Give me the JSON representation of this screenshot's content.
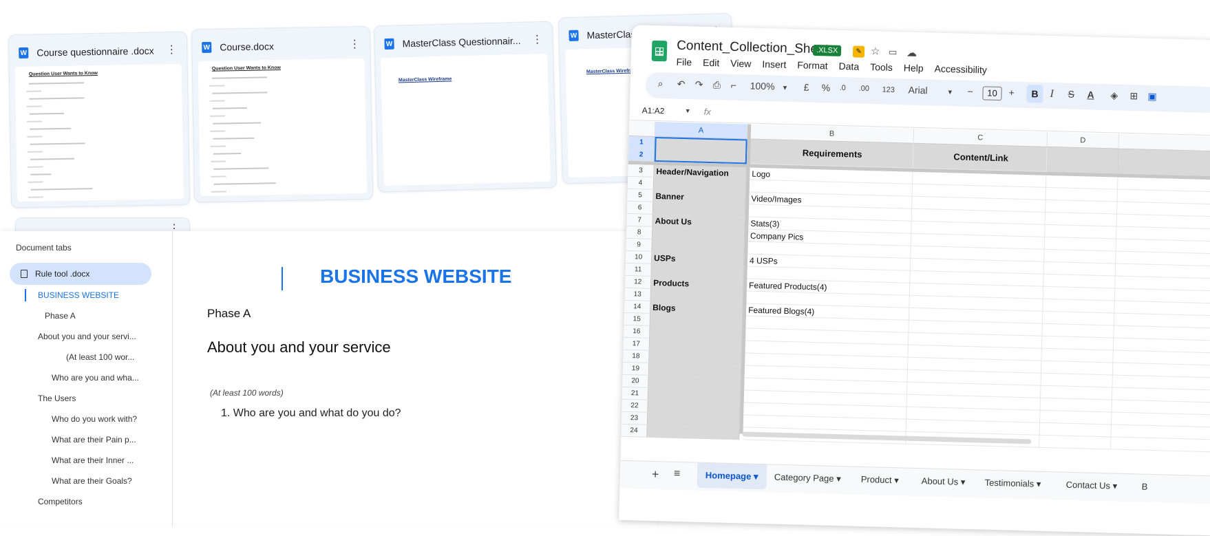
{
  "file_cards": [
    {
      "name": "Course questionnaire .docx",
      "thumb_title": "Question User Wants to Know"
    },
    {
      "name": "Course.docx",
      "thumb_title": "Question User Wants to Know"
    },
    {
      "name": "MasterClass Questionnair...",
      "thumb_title": "MasterClass Wireframe"
    },
    {
      "name": "MasterClass.docx",
      "thumb_title": "MasterClass Wirefra"
    }
  ],
  "file_icon_letter": "W",
  "docs": {
    "tabs_label": "Document tabs",
    "active_doc": "Rule tool .docx",
    "outline": [
      {
        "label": "BUSINESS WEBSITE",
        "level": 1,
        "current": true
      },
      {
        "label": "Phase A",
        "level": 2
      },
      {
        "label": "About you and your servi...",
        "level": 1
      },
      {
        "label": "(At least 100 wor...",
        "level": 3
      },
      {
        "label": "Who are you and wha...",
        "level": 2
      },
      {
        "label": "The Users",
        "level": 1
      },
      {
        "label": "Who do you work with?",
        "level": 2
      },
      {
        "label": "What are their Pain p...",
        "level": 2
      },
      {
        "label": "What are their Inner ...",
        "level": 2
      },
      {
        "label": "What are their Goals?",
        "level": 2
      },
      {
        "label": "Competitors",
        "level": 1
      }
    ],
    "body": {
      "title": "BUSINESS WEBSITE",
      "phase": "Phase A",
      "heading": "About you and your service",
      "note": "(At least 100 words)",
      "question": "1. Who are you and what do you do?"
    }
  },
  "sheets": {
    "title": "Content_Collection_Sheet",
    "badge": ".XLSX",
    "menu": [
      "File",
      "Edit",
      "View",
      "Insert",
      "Format",
      "Data",
      "Tools",
      "Help",
      "Accessibility"
    ],
    "toolbar": {
      "zoom": "100%",
      "currency": "£",
      "percent": "%",
      "dec_decrease": ".0",
      "dec_increase": ".00",
      "number_format": "123",
      "font": "Arial",
      "font_size": "10",
      "bold": "B",
      "italic": "I",
      "strike": "S",
      "text_color": "A"
    },
    "name_box": "A1:A2",
    "fx": "fx",
    "columns": [
      "A",
      "B",
      "C",
      "D"
    ],
    "header": {
      "requirements": "Requirements",
      "content": "Content/Link"
    },
    "rows": [
      {
        "n": "3",
        "a": "Header/Navigation",
        "b": "Logo"
      },
      {
        "n": "4",
        "a": "",
        "b": ""
      },
      {
        "n": "5",
        "a": "Banner",
        "b": "Video/Images"
      },
      {
        "n": "6",
        "a": "",
        "b": ""
      },
      {
        "n": "7",
        "a": "About Us",
        "b": "Stats(3)"
      },
      {
        "n": "8",
        "a": "",
        "b": "Company Pics"
      },
      {
        "n": "9",
        "a": "",
        "b": ""
      },
      {
        "n": "10",
        "a": "USPs",
        "b": "4 USPs"
      },
      {
        "n": "11",
        "a": "",
        "b": ""
      },
      {
        "n": "12",
        "a": "Products",
        "b": "Featured Products(4)"
      },
      {
        "n": "13",
        "a": "",
        "b": ""
      },
      {
        "n": "14",
        "a": "Blogs",
        "b": "Featured Blogs(4)"
      },
      {
        "n": "15",
        "a": "",
        "b": ""
      },
      {
        "n": "16",
        "a": "",
        "b": ""
      },
      {
        "n": "17",
        "a": "",
        "b": ""
      },
      {
        "n": "18",
        "a": "",
        "b": ""
      },
      {
        "n": "19",
        "a": "",
        "b": ""
      },
      {
        "n": "20",
        "a": "",
        "b": ""
      },
      {
        "n": "21",
        "a": "",
        "b": ""
      },
      {
        "n": "22",
        "a": "",
        "b": ""
      },
      {
        "n": "23",
        "a": "",
        "b": ""
      },
      {
        "n": "24",
        "a": "",
        "b": ""
      }
    ],
    "sheet_tabs": [
      "Homepage",
      "Category Page",
      "Product",
      "About Us",
      "Testimonials",
      "Contact Us",
      "B"
    ],
    "active_tab": "Homepage"
  }
}
